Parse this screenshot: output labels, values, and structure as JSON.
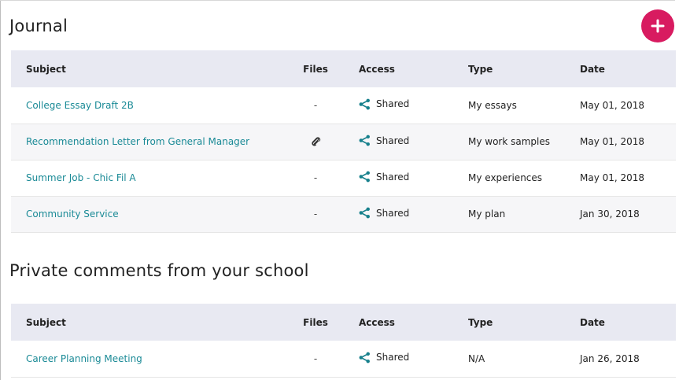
{
  "journal": {
    "title": "Journal",
    "add_button": "+",
    "columns": [
      "Subject",
      "Files",
      "Access",
      "Type",
      "Date"
    ],
    "rows": [
      {
        "subject": "College Essay Draft 2B",
        "files": "-",
        "access": "Shared",
        "type": "My essays",
        "date": "May 01, 2018"
      },
      {
        "subject": "Recommendation Letter from General Manager",
        "files": "",
        "files_icon": "paperclip-icon",
        "access": "Shared",
        "type": "My work samples",
        "date": "May 01, 2018"
      },
      {
        "subject": "Summer Job - Chic Fil A",
        "files": "-",
        "access": "Shared",
        "type": "My experiences",
        "date": "May 01, 2018"
      },
      {
        "subject": "Community Service",
        "files": "-",
        "access": "Shared",
        "type": "My plan",
        "date": "Jan 30, 2018"
      }
    ]
  },
  "private_comments": {
    "title": "Private comments from your school",
    "columns": [
      "Subject",
      "Files",
      "Access",
      "Type",
      "Date"
    ],
    "rows": [
      {
        "subject": "Career Planning Meeting",
        "files": "-",
        "access": "Shared",
        "type": "N/A",
        "date": "Jan 26, 2018"
      }
    ]
  },
  "colors": {
    "accent_link": "#1a8a96",
    "share_icon": "#17808c",
    "add_button": "#d81b60",
    "header_bg": "#e8e9f2",
    "row_alt_bg": "#f6f6f8"
  },
  "icons": {
    "add": "plus-icon",
    "access": "share-icon",
    "attachment": "paperclip-icon"
  }
}
